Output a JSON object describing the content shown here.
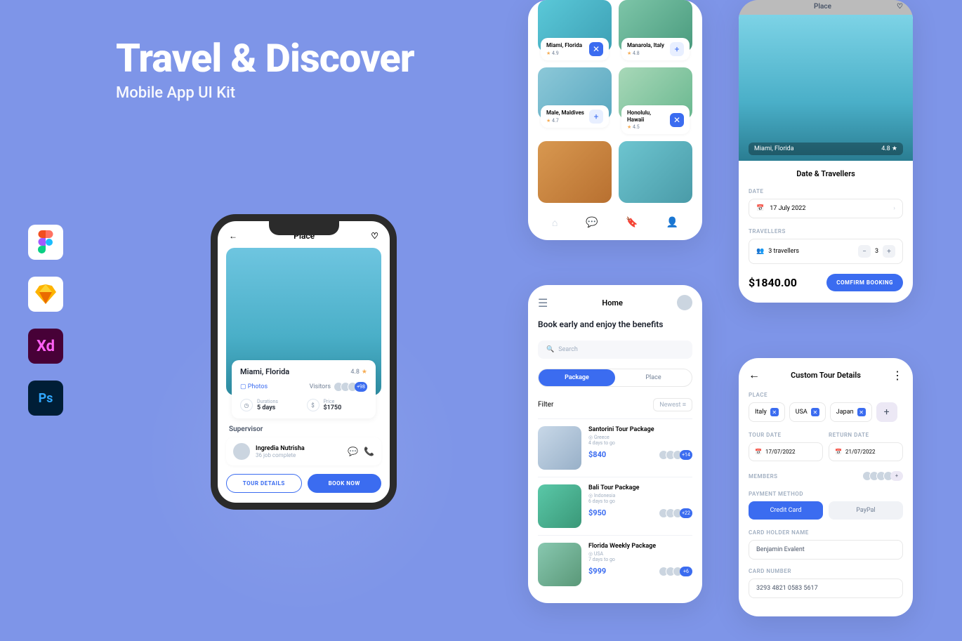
{
  "hero": {
    "title": "Travel & Discover",
    "subtitle": "Mobile App UI Kit"
  },
  "tools": {
    "figma": "Figma",
    "sketch": "Sketch",
    "xd": "Xd",
    "ps": "Ps"
  },
  "phone_main": {
    "header_title": "Place",
    "place_name": "Miami, Florida",
    "rating": "4.8",
    "photos_label": "Photos",
    "visitors_label": "Visitors",
    "visitors_count": "+98",
    "duration_label": "Durations",
    "duration_value": "5 days",
    "price_label": "Price",
    "price_value": "$1750",
    "supervisor_heading": "Supervisor",
    "supervisor_name": "Ingredia Nutrisha",
    "supervisor_sub": "36 job complete",
    "tour_details_btn": "TOUR DETAILS",
    "book_now_btn": "BOOK NOW"
  },
  "grid_screen": {
    "cards": [
      {
        "title": "Miami, Florida",
        "rating": "4.9",
        "action": "x"
      },
      {
        "title": "Manarola, Italy",
        "rating": "4.8",
        "action": "plus"
      },
      {
        "title": "Male, Maldives",
        "rating": "4.7",
        "action": "plus"
      },
      {
        "title": "Honolulu, Hawaii",
        "rating": "4.5",
        "action": "x"
      }
    ]
  },
  "place_screen": {
    "top_title": "Place",
    "place_name": "Miami, Florida",
    "rating": "4.8",
    "sheet_title": "Date & Travellers",
    "date_label": "DATE",
    "date_value": "17 July 2022",
    "travellers_label": "TRAVELLERS",
    "travellers_value": "3 travellers",
    "travellers_count": "3",
    "price": "$1840.00",
    "confirm_btn": "COMFIRM BOOKING"
  },
  "home_screen": {
    "title": "Home",
    "hero_text": "Book early and enjoy the benefits",
    "search_placeholder": "Search",
    "tab_package": "Package",
    "tab_place": "Place",
    "filter_label": "Filter",
    "sort_label": "Newest",
    "packages": [
      {
        "title": "Santorini Tour Package",
        "loc": "Greece",
        "days": "4 days to go",
        "price": "$840",
        "count": "+14"
      },
      {
        "title": "Bali Tour Package",
        "loc": "Indonesia",
        "days": "6 days to go",
        "price": "$950",
        "count": "+22"
      },
      {
        "title": "Florida Weekly Package",
        "loc": "USA",
        "days": "7 days to go",
        "price": "$999",
        "count": "+6"
      }
    ]
  },
  "custom_screen": {
    "title": "Custom Tour Details",
    "place_label": "PLACE",
    "places": [
      "Italy",
      "USA",
      "Japan"
    ],
    "tour_date_label": "TOUR DATE",
    "tour_date": "17/07/2022",
    "return_date_label": "RETURN DATE",
    "return_date": "21/07/2022",
    "members_label": "MEMBERS",
    "members_count": "+",
    "payment_label": "PAYMENT METHOD",
    "pay_cc": "Credit Card",
    "pay_pp": "PayPal",
    "holder_label": "CARD HOLDER NAME",
    "holder_value": "Benjamin Evalent",
    "card_label": "CARD NUMBER",
    "card_value": "3293 4821 0583 5617"
  }
}
